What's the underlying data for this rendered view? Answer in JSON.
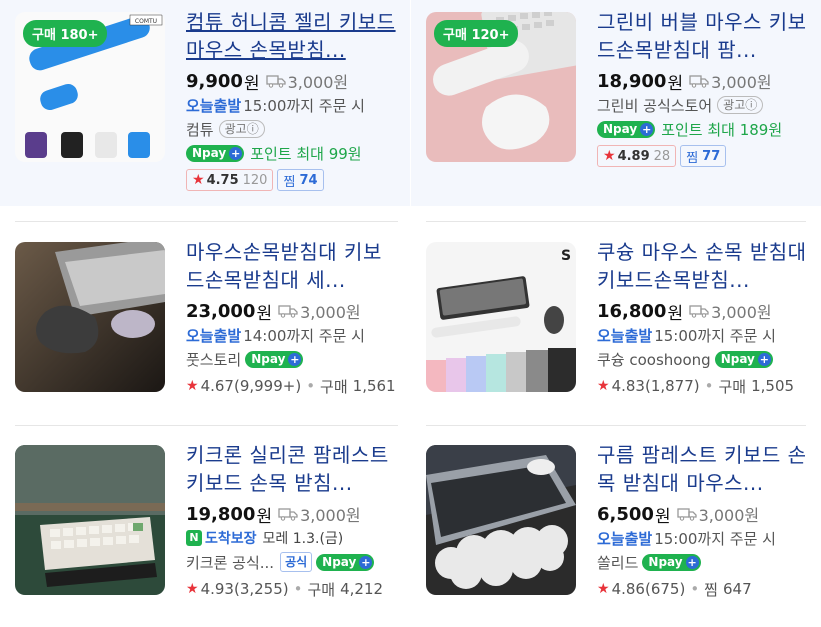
{
  "products": [
    {
      "title": "컴튜 허니콤 젤리 키보드 마우스 손목받침...",
      "badge": "구매 180+",
      "price": "9,900",
      "won": "원",
      "shipping": "3,000원",
      "today_label": "오늘출발",
      "cutoff": "15:00까지 주문 시",
      "seller": "컴튜",
      "ad_label": "광고ⓘ",
      "npay_label": "pay",
      "point_text": "포인트 최대 99원",
      "rating": "4.75",
      "review_count": "120",
      "zzim_label": "찜",
      "zzim_count": "74"
    },
    {
      "title": "그린비 버블 마우스 키보드손목받침대 팜...",
      "badge": "구매 120+",
      "price": "18,900",
      "won": "원",
      "shipping": "3,000원",
      "seller": "그린비 공식스토어",
      "ad_label": "광고ⓘ",
      "npay_label": "pay",
      "point_text": "포인트 최대 189원",
      "rating": "4.89",
      "review_count": "28",
      "zzim_label": "찜",
      "zzim_count": "77"
    },
    {
      "title": "마우스손목받침대 키보드손목받침대 세...",
      "price": "23,000",
      "won": "원",
      "shipping": "3,000원",
      "today_label": "오늘출발",
      "cutoff": "14:00까지 주문 시",
      "seller": "풋스토리",
      "npay_label": "pay",
      "rating": "4.67",
      "review_count": "(9,999+)",
      "purchase_label": "구매",
      "purchase_count": "1,561"
    },
    {
      "title": "쿠슝 마우스 손목 받침대 키보드손목받침...",
      "price": "16,800",
      "won": "원",
      "shipping": "3,000원",
      "today_label": "오늘출발",
      "cutoff": "15:00까지 주문 시",
      "seller": "쿠슝 cooshoong",
      "npay_label": "pay",
      "rating": "4.83",
      "review_count": "(1,877)",
      "purchase_label": "구매",
      "purchase_count": "1,505"
    },
    {
      "title": "키크론 실리콘 팜레스트 키보드 손목 받침...",
      "price": "19,800",
      "won": "원",
      "shipping": "3,000원",
      "delivery_label": "도착보장",
      "delivery_date": "모레 1.3.(금)",
      "seller": "키크론 공식...",
      "official_tag": "공식",
      "npay_label": "pay",
      "rating": "4.93",
      "review_count": "(3,255)",
      "purchase_label": "구매",
      "purchase_count": "4,212"
    },
    {
      "title": "구름 팜레스트 키보드 손목 받침대 마우스...",
      "price": "6,500",
      "won": "원",
      "shipping": "3,000원",
      "today_label": "오늘출발",
      "cutoff": "15:00까지 주문 시",
      "seller": "쏠리드",
      "npay_label": "pay",
      "rating": "4.86",
      "review_count": "(675)",
      "zzim_label": "찜",
      "zzim_count": "647"
    }
  ],
  "thumb_brand": "COMTU",
  "colors": {
    "title": "#1a3b8d",
    "green": "#1fb24f",
    "blue": "#2d6bd6",
    "star": "#e8333a"
  }
}
